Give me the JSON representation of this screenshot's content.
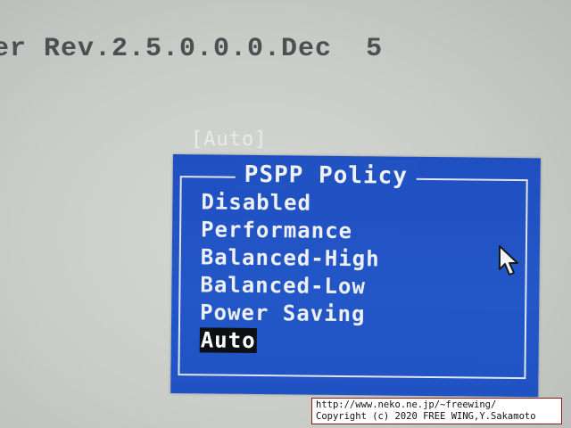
{
  "header": {
    "version_text": "er Rev.2.5.0.0.0.Dec  5"
  },
  "setting": {
    "current_value": "[Auto]"
  },
  "popup": {
    "title": "PSPP Policy",
    "options": [
      "Disabled",
      "Performance",
      "Balanced-High",
      "Balanced-Low",
      "Power Saving",
      "Auto"
    ],
    "selected": "Auto"
  },
  "icons": {
    "cursor": "mouse-pointer-icon"
  },
  "watermark": {
    "line1": "http://www.neko.ne.jp/~freewing/",
    "line2": "Copyright (c) 2020 FREE WING,Y.Sakamoto"
  },
  "colors": {
    "popup_background": "#2357c8",
    "popup_text": "#eef0f3",
    "selection_background": "#0d0f14",
    "screen_background": "#c9ccc7"
  }
}
